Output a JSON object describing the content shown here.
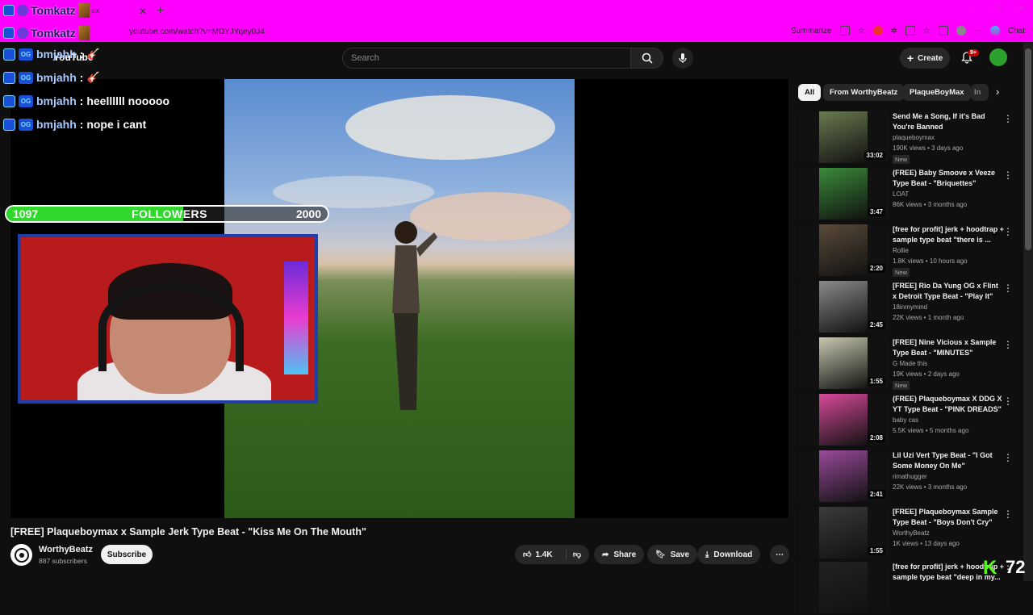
{
  "browser": {
    "tab_title": "Tomkatz",
    "tab_fragment": "ax",
    "url": "youtube.com/watch?v=MDYJYqey0J4",
    "summarize_label": "Summarize",
    "chat_label": "Chat"
  },
  "youtube": {
    "logo_text": "YouTube",
    "search_placeholder": "Search",
    "create_label": "Create",
    "notification_count": "9+"
  },
  "chat_overlay": [
    {
      "user": "bmjahh",
      "message": ":"
    },
    {
      "user": "bmjahh",
      "message": ":"
    },
    {
      "user": "bmjahh",
      "message": ": heellllll nooooo"
    },
    {
      "user": "bmjahh",
      "message": ": nope i cant"
    }
  ],
  "follower_goal": {
    "current": "1097",
    "label": "FOLLOWERS",
    "target": "2000",
    "fraction": 0.55
  },
  "video": {
    "title": "[FREE] Plaqueboymax x Sample Jerk Type Beat - \"Kiss Me On The Mouth\"",
    "channel": "WorthyBeatz",
    "subscribers": "887 subscribers",
    "subscribe_label": "Subscribe",
    "likes": "1.4K",
    "share_label": "Share",
    "save_label": "Save",
    "download_label": "Download"
  },
  "filter_chips": [
    "All",
    "From WorthyBeatz",
    "PlaqueBoyMax",
    "In"
  ],
  "recommendations": [
    {
      "title": "Send Me a Song, If it's Bad You're Banned",
      "channel": "plaqueboymax",
      "meta": "190K views • 3 days ago",
      "duration": "33:02",
      "badge": "New",
      "color": "#6a7a50"
    },
    {
      "title": "(FREE) Baby Smoove x Veeze Type Beat - \"Briquettes\"",
      "channel": "LOAT",
      "meta": "86K views • 3 months ago",
      "duration": "3:47",
      "badge": "",
      "color": "#3b8a3a"
    },
    {
      "title": "[free for profit] jerk + hoodtrap + sample type beat \"there is ...",
      "channel": "Rollie",
      "meta": "1.8K views • 10 hours ago",
      "duration": "2:20",
      "badge": "New",
      "color": "#5a4a3a"
    },
    {
      "title": "[FREE] Rio Da Yung OG x Flint x Detroit Type Beat - \"Play It\"",
      "channel": "18inmymind",
      "meta": "22K views • 1 month ago",
      "duration": "2:45",
      "badge": "",
      "color": "#8a8a8a"
    },
    {
      "title": "[FREE] Nine Vicious x Sample Type Beat - \"MINUTES\"",
      "channel": "G Made this",
      "meta": "19K views • 2 days ago",
      "duration": "1:55",
      "badge": "New",
      "color": "#c8c8b0"
    },
    {
      "title": "(FREE) Plaqueboymax X DDG X YT Type Beat - \"PINK DREADS\"",
      "channel": "baby cas",
      "meta": "5.5K views • 5 months ago",
      "duration": "2:08",
      "badge": "",
      "color": "#d84a9a"
    },
    {
      "title": "Lil Uzi Vert Type Beat - \"I Got Some Money On Me\"",
      "channel": "rimathugger",
      "meta": "22K views • 3 months ago",
      "duration": "2:41",
      "badge": "",
      "color": "#9a4a9a"
    },
    {
      "title": "[FREE] Plaqueboymax Sample Type Beat - \"Boys Don't Cry\"",
      "channel": "WorthyBeatz",
      "meta": "1K views • 13 days ago",
      "duration": "1:55",
      "badge": "",
      "color": "#3a3a3a"
    },
    {
      "title": "[free for profit] jerk + hoodtrap + sample type beat \"deep in my...",
      "channel": "",
      "meta": "",
      "duration": "",
      "badge": "",
      "color": "#222"
    }
  ],
  "overlay_corner": {
    "k": "K",
    "number": "72"
  }
}
